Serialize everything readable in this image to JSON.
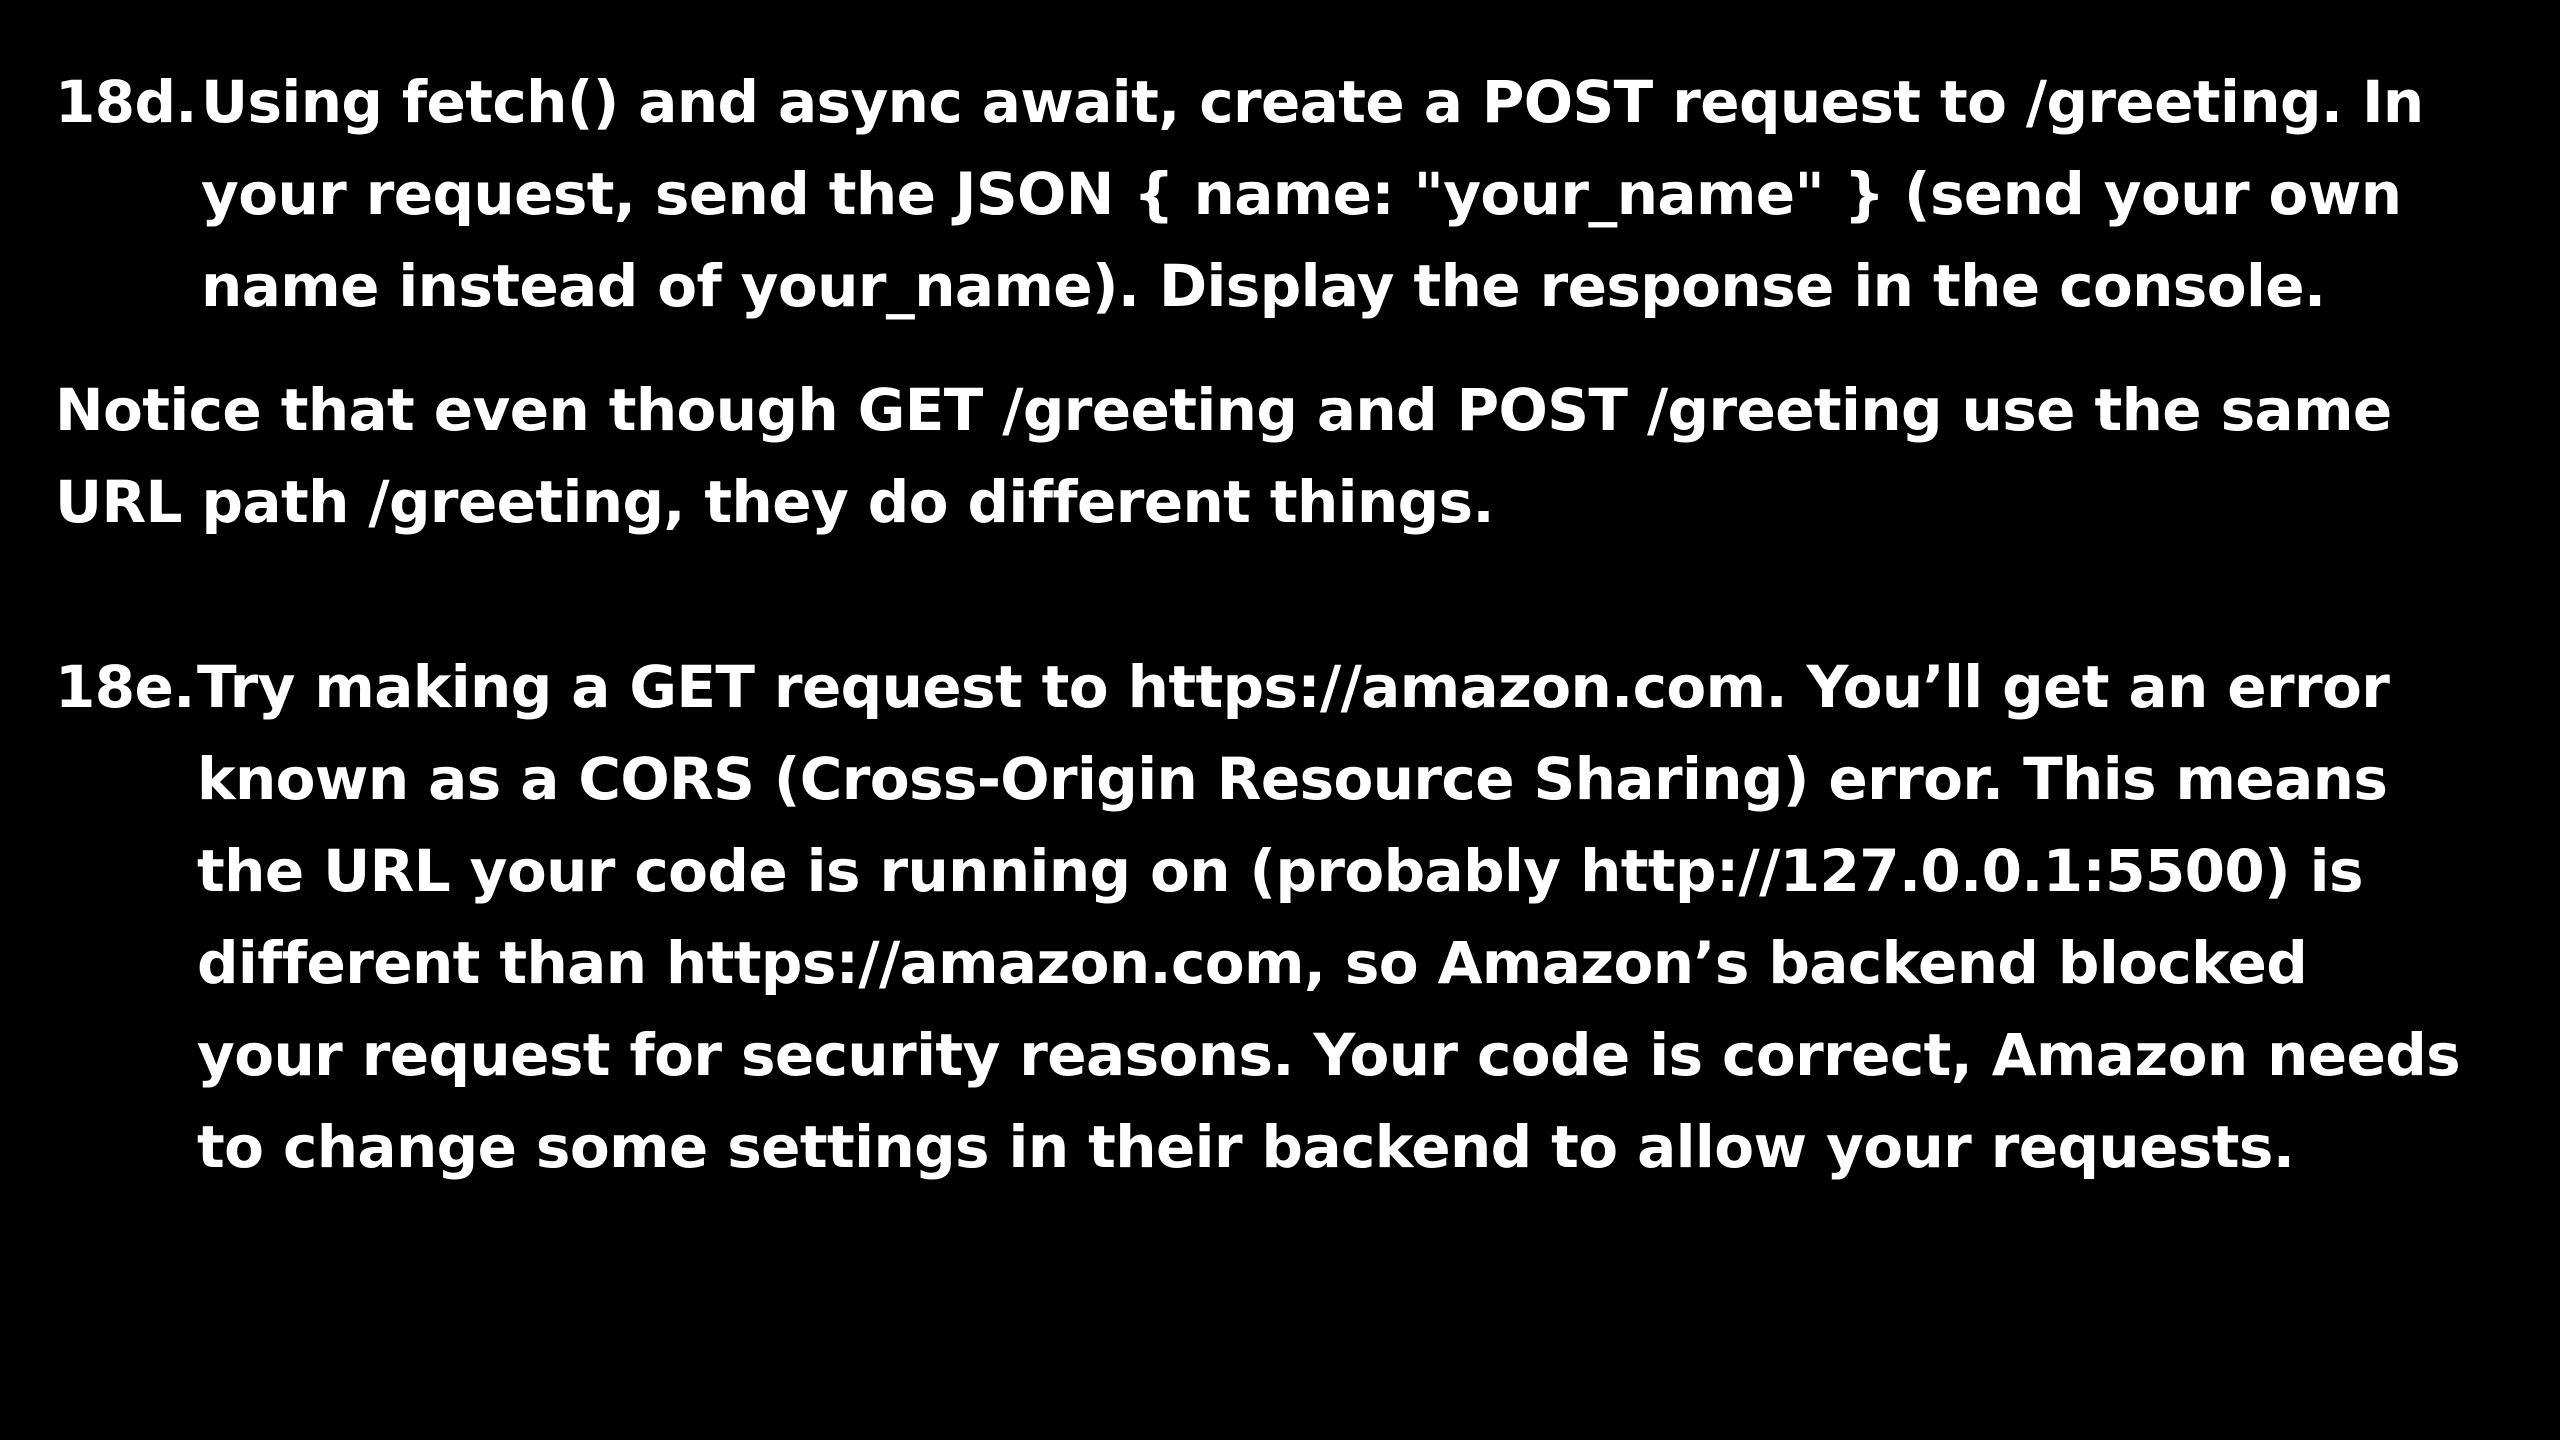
{
  "slide": {
    "background": "#000000",
    "text_color": "#ffffff",
    "item_18d": {
      "number": "18d.",
      "lines": [
        "Using fetch() and async await, create a POST request to /greeting. In",
        "your request, send the JSON { name: \"your_name\" } (send your own",
        "name instead of your_name). Display the response in the console."
      ]
    },
    "notice": {
      "lines": [
        "Notice that even though GET /greeting and POST /greeting use the same",
        "URL path /greeting, they do different things."
      ]
    },
    "item_18e": {
      "number": "18e.",
      "lines": [
        "Try making a GET request to https://amazon.com. You’ll get an error",
        "known as a CORS (Cross-Origin Resource Sharing) error. This means",
        "the URL your code is running on (probably http://127.0.0.1:5500) is",
        "different than https://amazon.com, so Amazon’s backend blocked",
        "your request for security reasons. Your code is correct, Amazon needs",
        "to change some settings in their backend to allow your requests."
      ]
    }
  }
}
